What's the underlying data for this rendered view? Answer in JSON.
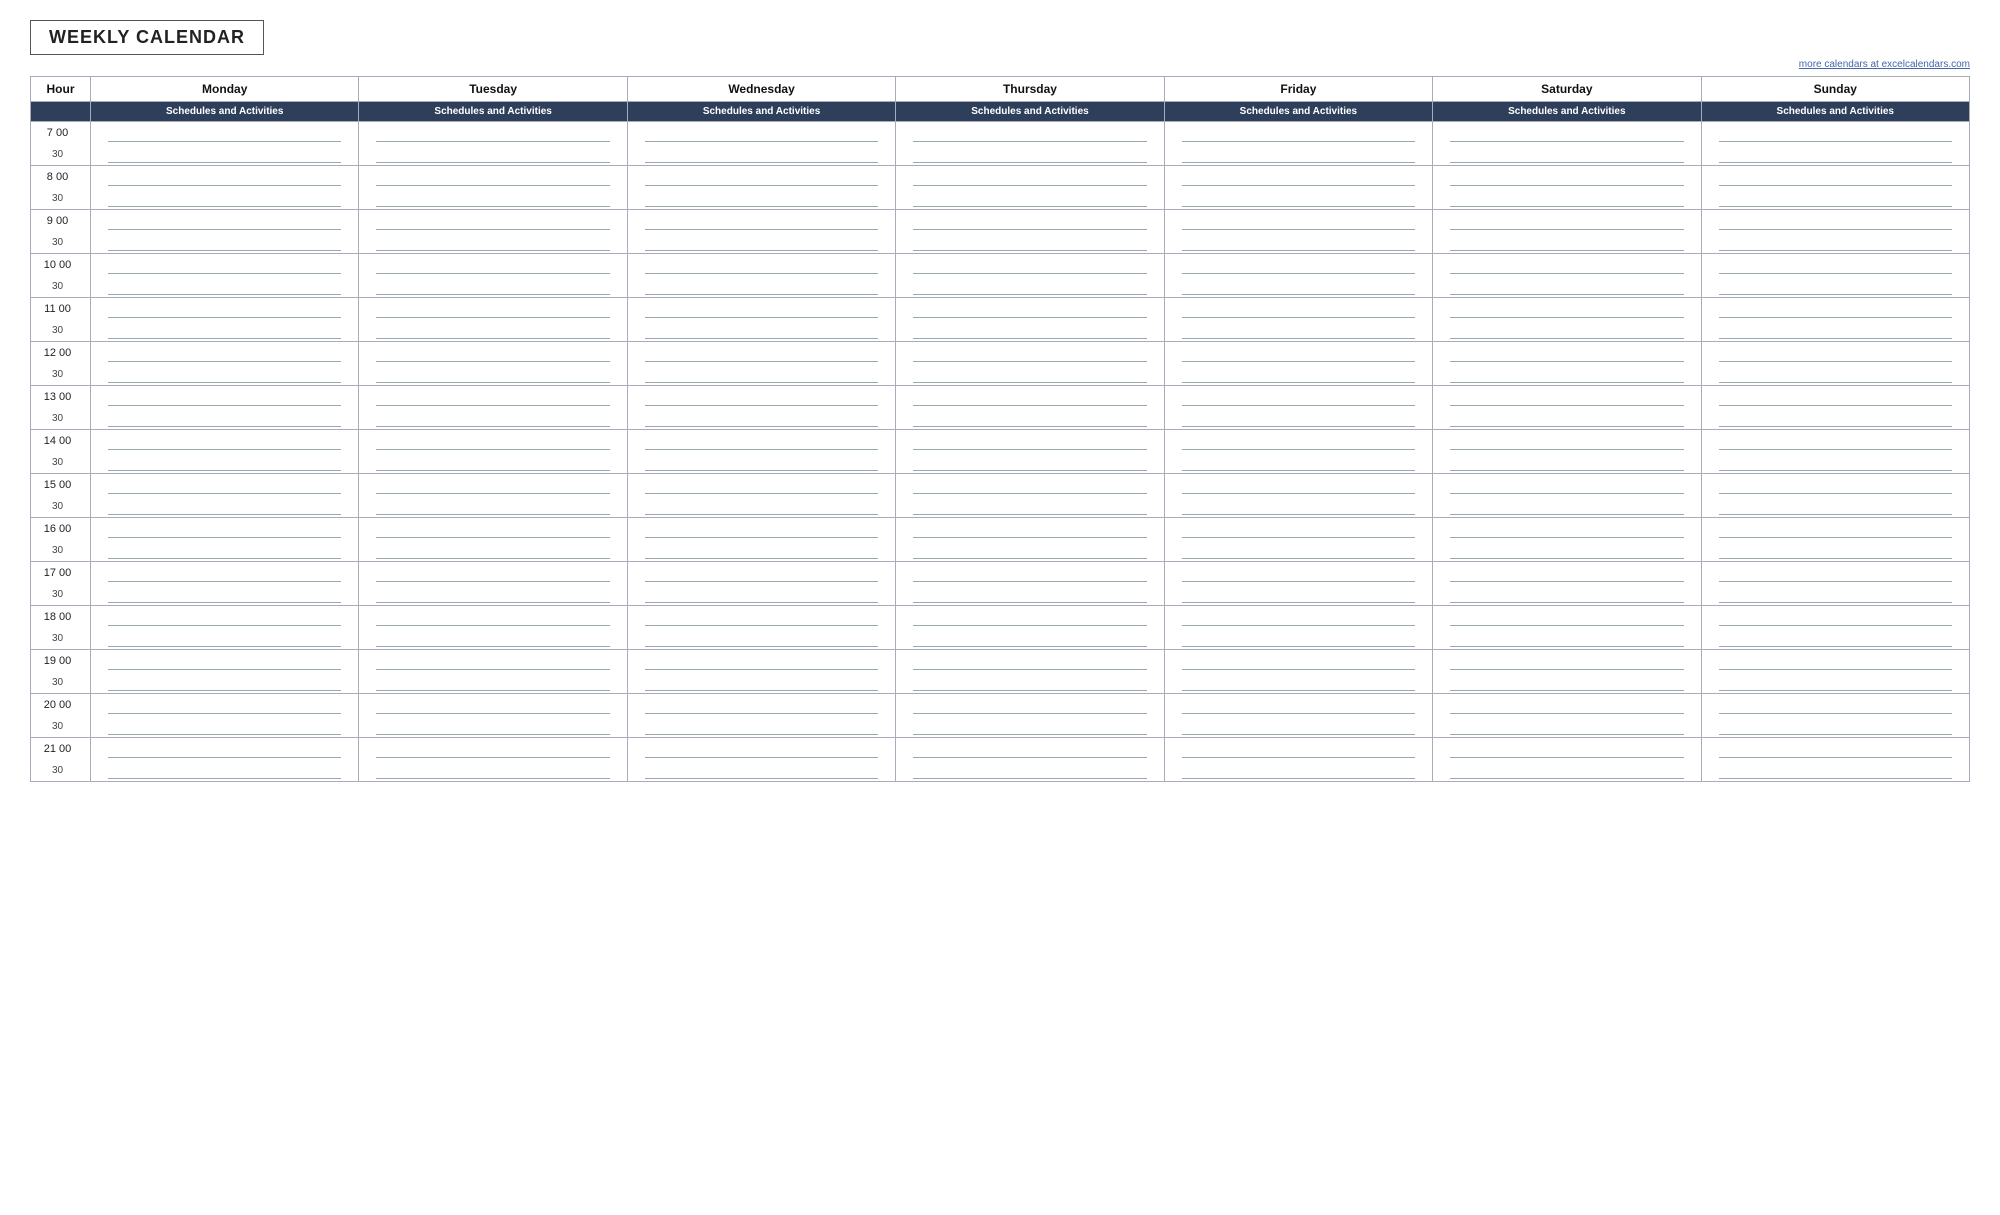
{
  "title": "WEEKLY CALENDAR",
  "attribution": "more calendars at excelcalendars.com",
  "columns": {
    "hour_label": "Hour",
    "days": [
      "Monday",
      "Tuesday",
      "Wednesday",
      "Thursday",
      "Friday",
      "Saturday",
      "Sunday"
    ]
  },
  "sub_header_label": "Schedules and Activities",
  "hours": [
    {
      "label": "7  00",
      "half_label": "30"
    },
    {
      "label": "8  00",
      "half_label": "30"
    },
    {
      "label": "9  00",
      "half_label": "30"
    },
    {
      "label": "10  00",
      "half_label": "30"
    },
    {
      "label": "11  00",
      "half_label": "30"
    },
    {
      "label": "12  00",
      "half_label": "30"
    },
    {
      "label": "13  00",
      "half_label": "30"
    },
    {
      "label": "14  00",
      "half_label": "30"
    },
    {
      "label": "15  00",
      "half_label": "30"
    },
    {
      "label": "16  00",
      "half_label": "30"
    },
    {
      "label": "17  00",
      "half_label": "30"
    },
    {
      "label": "18  00",
      "half_label": "30"
    },
    {
      "label": "19  00",
      "half_label": "30"
    },
    {
      "label": "20  00",
      "half_label": "30"
    },
    {
      "label": "21  00",
      "half_label": "30"
    }
  ]
}
